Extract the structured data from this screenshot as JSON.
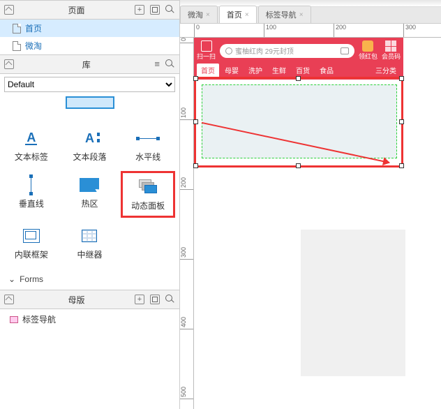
{
  "panels": {
    "pages": {
      "title": "页面",
      "items": [
        {
          "label": "首页",
          "selected": true
        },
        {
          "label": "微淘",
          "selected": false
        }
      ]
    },
    "library": {
      "title": "库",
      "dropdown": "Default",
      "widgets": [
        {
          "name": "文本标签"
        },
        {
          "name": "文本段落"
        },
        {
          "name": "水平线"
        },
        {
          "name": "垂直线"
        },
        {
          "name": "热区"
        },
        {
          "name": "动态面板"
        },
        {
          "name": "内联框架"
        },
        {
          "name": "中继器"
        }
      ],
      "forms_section": "Forms"
    },
    "masters": {
      "title": "母版",
      "items": [
        {
          "label": "标签导航"
        }
      ]
    }
  },
  "tabs": [
    {
      "label": "微淘",
      "active": false
    },
    {
      "label": "首页",
      "active": true
    },
    {
      "label": "标签导航",
      "active": false
    }
  ],
  "ruler_h": [
    0,
    100,
    200,
    300
  ],
  "ruler_v": [
    0,
    100,
    200,
    300,
    400,
    500
  ],
  "mock": {
    "scan_label": "扫一扫",
    "search_placeholder": "蜜柚红肉 29元封顶",
    "redpack": "领红包",
    "membercode": "会员码",
    "nav": [
      "首页",
      "母婴",
      "洗护",
      "生鲜",
      "百货",
      "食品"
    ],
    "nav_more": "三分类"
  }
}
